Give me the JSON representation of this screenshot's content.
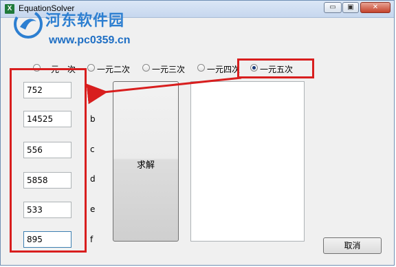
{
  "window": {
    "title": "EquationSolver",
    "app_icon": "X"
  },
  "watermark": {
    "name": "河东软件园",
    "url": "www.pc0359.cn"
  },
  "title_buttons": {
    "minimize": "▭",
    "maximize": "▣",
    "close": "✕"
  },
  "radio_options": [
    {
      "label": "一元一次",
      "checked": false
    },
    {
      "label": "一元二次",
      "checked": false
    },
    {
      "label": "一元三次",
      "checked": false
    },
    {
      "label": "一元四次",
      "checked": false
    },
    {
      "label": "一元五次",
      "checked": true
    }
  ],
  "coefficients": [
    {
      "letter": "a",
      "value": "752"
    },
    {
      "letter": "b",
      "value": "14525"
    },
    {
      "letter": "c",
      "value": "556"
    },
    {
      "letter": "d",
      "value": "5858"
    },
    {
      "letter": "e",
      "value": "533"
    },
    {
      "letter": "f",
      "value": "895"
    }
  ],
  "solve_button": {
    "label": "求解"
  },
  "cancel_button": {
    "label": "取消"
  },
  "annotation_color": "#d81e1e"
}
